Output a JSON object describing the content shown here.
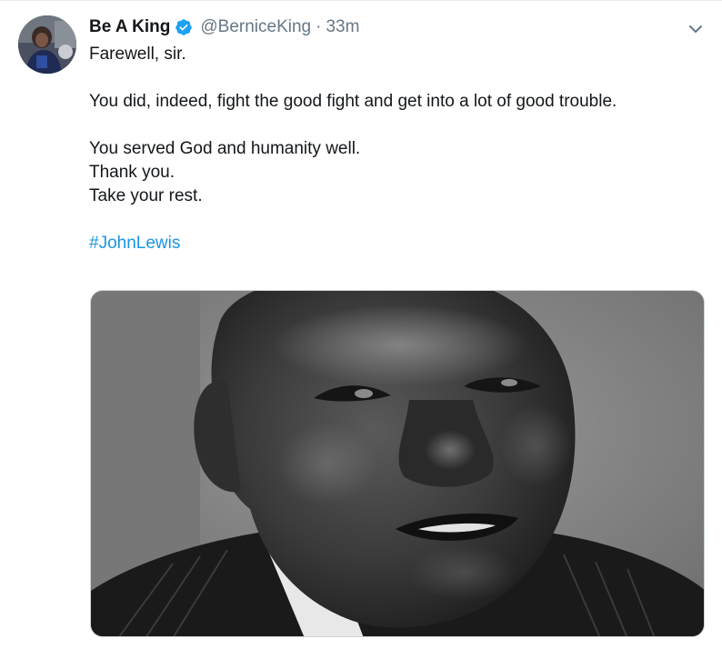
{
  "author": {
    "display_name": "Be A King",
    "handle": "@BerniceKing",
    "separator": "·",
    "time": "33m",
    "verified": true,
    "verified_color": "#1da1f2"
  },
  "tweet": {
    "lines": [
      "Farewell, sir.",
      "You did, indeed, fight the good fight and get into a lot of good trouble.",
      "You served God and humanity well.",
      "Thank you.",
      "Take your rest."
    ],
    "hashtag": "#JohnLewis",
    "hashtag_color": "#1b95e0"
  },
  "icons": {
    "avatar": "profile-photo",
    "verified": "verified-badge-icon",
    "menu": "chevron-down-icon"
  },
  "media": {
    "kind": "black-and-white portrait photo"
  }
}
